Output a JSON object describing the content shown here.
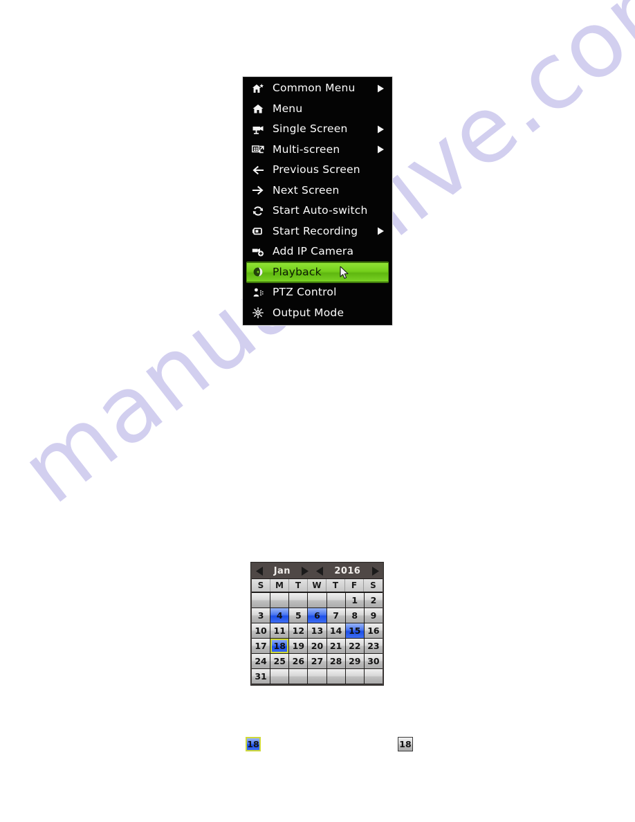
{
  "watermark": {
    "text": "manualshive.com",
    "color": "#c8c4ec"
  },
  "context_menu": {
    "name": "DVR right-click context menu",
    "background_color": "#040404",
    "highlight_color": "#74cf1c",
    "items": [
      {
        "label": "Common Menu",
        "icon": "home-star-icon",
        "has_submenu": true,
        "selected": false
      },
      {
        "label": "Menu",
        "icon": "home-icon",
        "has_submenu": false,
        "selected": false
      },
      {
        "label": "Single Screen",
        "icon": "camera-icon",
        "has_submenu": true,
        "selected": false
      },
      {
        "label": "Multi-screen",
        "icon": "multi-screen-icon",
        "has_submenu": true,
        "selected": false
      },
      {
        "label": "Previous Screen",
        "icon": "arrow-left-icon",
        "has_submenu": false,
        "selected": false
      },
      {
        "label": "Next Screen",
        "icon": "arrow-right-icon",
        "has_submenu": false,
        "selected": false
      },
      {
        "label": "Start Auto-switch",
        "icon": "refresh-icon",
        "has_submenu": false,
        "selected": false
      },
      {
        "label": "Start Recording",
        "icon": "video-camera-icon",
        "has_submenu": true,
        "selected": false
      },
      {
        "label": "Add IP Camera",
        "icon": "camera-plus-icon",
        "has_submenu": false,
        "selected": false
      },
      {
        "label": "Playback",
        "icon": "playback-disc-icon",
        "has_submenu": false,
        "selected": true
      },
      {
        "label": "PTZ Control",
        "icon": "ptz-icon",
        "has_submenu": false,
        "selected": false
      },
      {
        "label": "Output Mode",
        "icon": "brightness-icon",
        "has_submenu": false,
        "selected": false
      }
    ]
  },
  "calendar": {
    "month": "Jan",
    "year": "2016",
    "prev_month_icon": "triangle-left-icon",
    "next_month_icon": "triangle-right-icon",
    "prev_year_icon": "triangle-left-icon",
    "next_year_icon": "triangle-right-icon",
    "weekdays": [
      "S",
      "M",
      "T",
      "W",
      "T",
      "F",
      "S"
    ],
    "selected_day": 18,
    "days_with_records": [
      4,
      6,
      15,
      18
    ],
    "weeks": [
      [
        "",
        "",
        "",
        "",
        "",
        "1",
        "2"
      ],
      [
        "3",
        "4",
        "5",
        "6",
        "7",
        "8",
        "9"
      ],
      [
        "10",
        "11",
        "12",
        "13",
        "14",
        "15",
        "16"
      ],
      [
        "17",
        "18",
        "19",
        "20",
        "21",
        "22",
        "23"
      ],
      [
        "24",
        "25",
        "26",
        "27",
        "28",
        "29",
        "30"
      ],
      [
        "31",
        "",
        "",
        "",
        "",
        "",
        ""
      ]
    ]
  },
  "legend": {
    "selected_day_cell": "18",
    "normal_day_cell": "18"
  }
}
